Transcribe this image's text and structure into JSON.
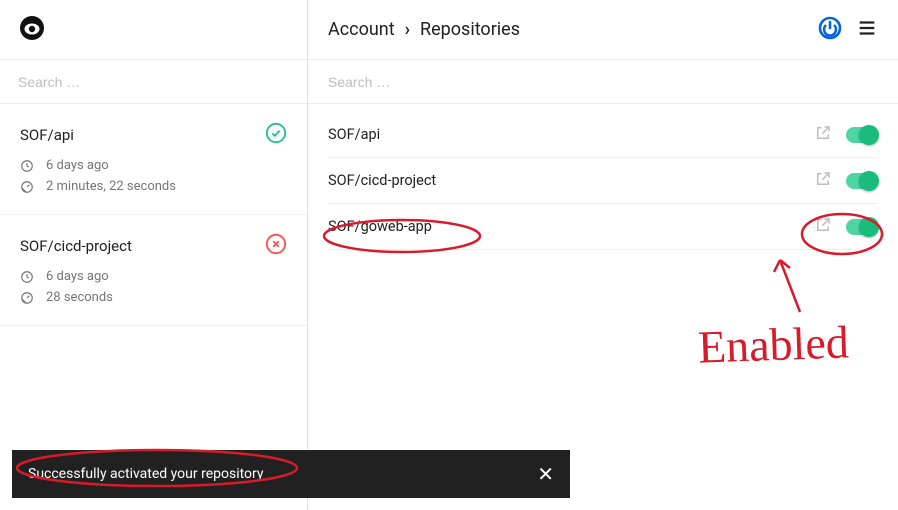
{
  "sidebar": {
    "search_placeholder": "Search …",
    "builds": [
      {
        "title": "SOF/api",
        "status": "success",
        "age": "6 days ago",
        "duration": "2 minutes, 22 seconds"
      },
      {
        "title": "SOF/cicd-project",
        "status": "failure",
        "age": "6 days ago",
        "duration": "28 seconds"
      }
    ]
  },
  "breadcrumb": {
    "account": "Account",
    "page": "Repositories"
  },
  "main": {
    "search_placeholder": "Search …",
    "repos": [
      {
        "name": "SOF/api",
        "enabled": true
      },
      {
        "name": "SOF/cicd-project",
        "enabled": true
      },
      {
        "name": "SOF/goweb-app",
        "enabled": true
      }
    ]
  },
  "toast": {
    "message": "Successfully activated your repository"
  },
  "annotations": {
    "label": "Enabled"
  },
  "colors": {
    "success": "#23c18c",
    "failure": "#ff4d4d",
    "accent": "#0066d6",
    "toggle": "#1abc7d",
    "ink": "#d81b2a"
  }
}
